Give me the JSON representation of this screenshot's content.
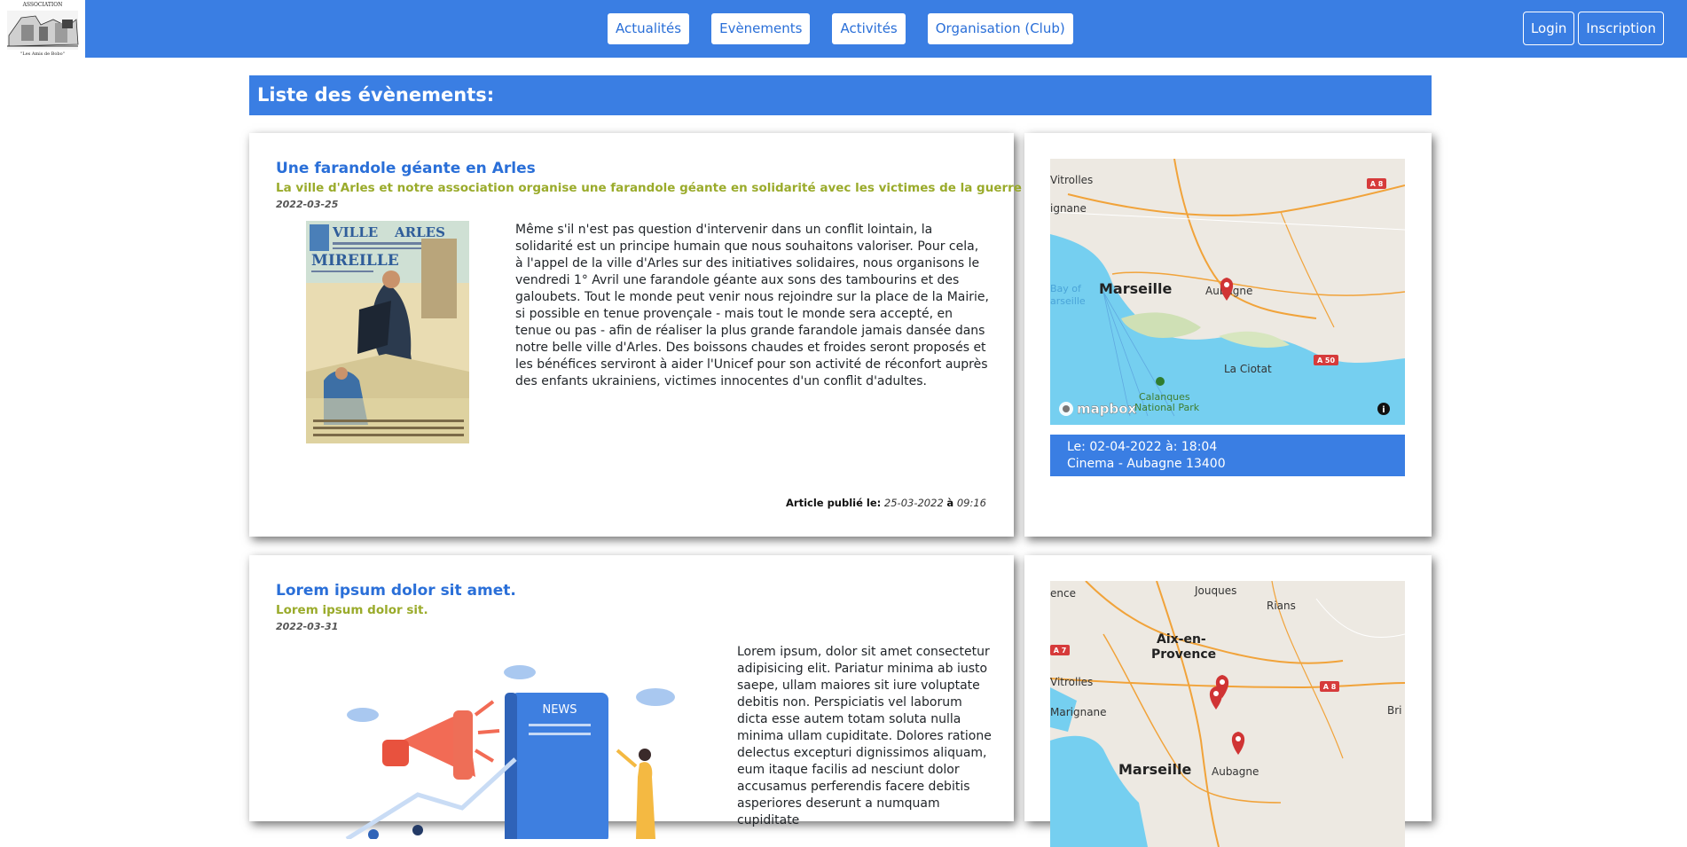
{
  "navbar": {
    "logo_text_top": "ASSOCIATION",
    "logo_text_bottom": "\"Les Amis de Bobo\"",
    "links": [
      "Actualités",
      "Evènements",
      "Activités",
      "Organisation (Club)"
    ],
    "login": "Login",
    "signup": "Inscription",
    "colors": {
      "bar": "#3a7ee3",
      "link_text": "#2a6fd8"
    }
  },
  "page": {
    "list_title": "Liste des évènements:"
  },
  "events": [
    {
      "title": "Une farandole géante en Arles",
      "subtitle": "La ville d'Arles et notre association organise une farandole géante en solidarité avec les victimes de la guerre en Ukraine",
      "date": "2022-03-25",
      "body": "Même s'il n'est pas question d'intervenir dans un conflit lointain, la solidarité est un principe humain que nous souhaitons valoriser. Pour cela, à l'appel de la ville d'Arles sur des initiatives solidaires, nous organisons le vendredi 1° Avril une farandole géante aux sons des tambourins et des galoubets. Tout le monde peut venir nous rejoindre sur la place de la Mairie, si possible en tenue provençale - mais tout le monde sera accepté, en tenue ou pas - afin de réaliser la plus grande farandole jamais dansée dans notre belle ville d'Arles. Des boissons chaudes et froides seront proposés et les bénéfices serviront à aider l'Unicef pour son activité de réconfort auprès des enfants ukrainiens, victimes innocentes d'un conflit d'adultes.",
      "published_label": "Article publié le:",
      "published_date": "25-03-2022",
      "published_at": "à",
      "published_time": "09:16",
      "poster": {
        "line1": "VILLE",
        "line2": "ARLES",
        "line3": "MIREILLE"
      },
      "map": {
        "labels": [
          "Vitrolles",
          "ignane",
          "Marseille",
          "Aubagne",
          "La Ciotat",
          "Calanques",
          "National Park",
          "Bay of",
          "arseille"
        ],
        "road_labels": [
          "A 8",
          "A 50"
        ],
        "brand": "mapbox"
      },
      "event_when": "Le: 02-04-2022 à: 18:04",
      "event_where": "Cinema - Aubagne 13400"
    },
    {
      "title": "Lorem ipsum dolor sit amet.",
      "subtitle": "Lorem ipsum dolor sit.",
      "date": "2022-03-31",
      "body": "Lorem ipsum, dolor sit amet consectetur adipisicing elit. Pariatur minima ab iusto saepe, ullam maiores sit iure voluptate debitis non. Perspiciatis vel laborum dicta esse autem totam soluta nulla minima ullam cupiditate. Dolores ratione delectus excepturi dignissimos aliquam, eum itaque facilis ad nesciunt dolor accusamus perferendis facere debitis asperiores deserunt a numquam cupiditate",
      "illustration_label": "NEWS",
      "map": {
        "labels": [
          "ence",
          "Jouques",
          "Rians",
          "Aix-en-",
          "Provence",
          "Vitrolles",
          "Marignane",
          "Marseille",
          "Aubagne",
          "Bri"
        ],
        "road_labels": [
          "A 7",
          "A 8"
        ]
      }
    }
  ]
}
